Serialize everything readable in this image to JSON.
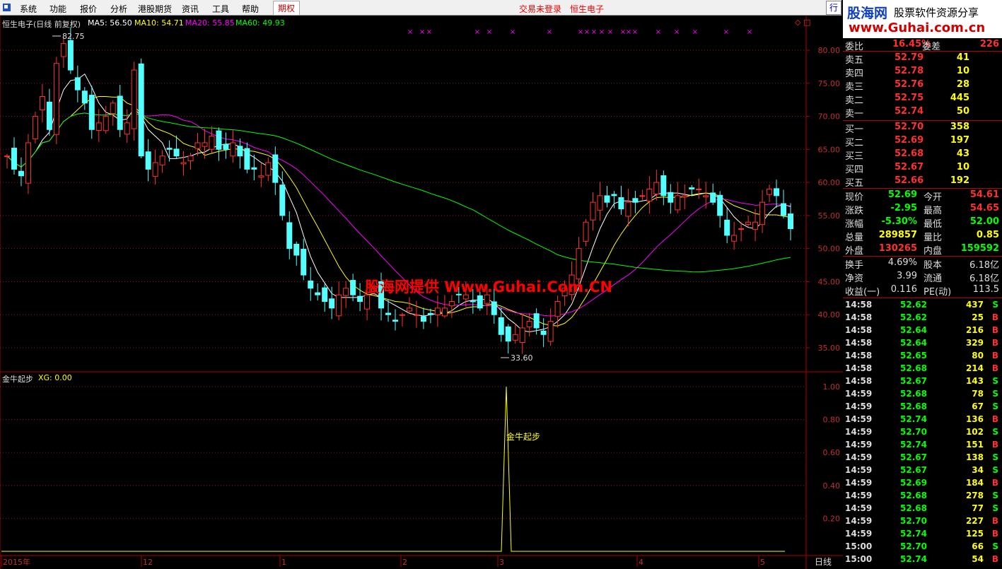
{
  "menu": {
    "items": [
      "系统",
      "功能",
      "报价",
      "分析",
      "港股期货",
      "资讯",
      "工具",
      "帮助"
    ],
    "active": "期权",
    "login_status": "交易未登录",
    "stock_name": "恒生电子",
    "trade_btn": "行"
  },
  "brand": {
    "line1": "股海网",
    "line2": "股票软件资源分享",
    "line3": "www.Guhai.com.cn"
  },
  "watermark": "股海网提供 Www.Guhai.Com.CN",
  "main_chart": {
    "title": "恒生电子(日线 前复权)",
    "ma": [
      {
        "label": "MA5: 56.50",
        "color": "#ffffff"
      },
      {
        "label": "MA10: 54.71",
        "color": "#ffff00"
      },
      {
        "label": "MA20: 55.85",
        "color": "#ff00ff"
      },
      {
        "label": "MA60: 49.93",
        "color": "#00ff00"
      }
    ],
    "y_ticks": [
      "80.00",
      "75.00",
      "70.00",
      "65.00",
      "60.00",
      "55.00",
      "50.00",
      "45.00",
      "40.00",
      "35.00"
    ],
    "high_label": "82.75",
    "low_label": "33.60"
  },
  "chart_data": {
    "type": "candlestick",
    "ylim": [
      32,
      84
    ],
    "x_labels": [
      "2015年",
      "12",
      "1",
      "2",
      "3",
      "4",
      "5"
    ],
    "indicator": {
      "title": "金牛起步",
      "xg_label": "XG: 0.00",
      "y_ticks": [
        "1.00",
        "0.80",
        "0.60",
        "0.40",
        "0.20"
      ],
      "signal_label": "金牛起步",
      "signal_value": 1.0
    }
  },
  "period_label": "日线",
  "quote": {
    "weibi": {
      "label": "委比",
      "value": "16.45%",
      "label2": "委差",
      "value2": "226"
    },
    "sells": [
      {
        "label": "卖五",
        "price": "52.79",
        "vol": "41"
      },
      {
        "label": "卖四",
        "price": "52.78",
        "vol": "10"
      },
      {
        "label": "卖三",
        "price": "52.76",
        "vol": "28"
      },
      {
        "label": "卖二",
        "price": "52.75",
        "vol": "445"
      },
      {
        "label": "卖一",
        "price": "52.74",
        "vol": "50"
      }
    ],
    "buys": [
      {
        "label": "买一",
        "price": "52.70",
        "vol": "358"
      },
      {
        "label": "买二",
        "price": "52.69",
        "vol": "197"
      },
      {
        "label": "买三",
        "price": "52.68",
        "vol": "43"
      },
      {
        "label": "买四",
        "price": "52.67",
        "vol": "10"
      },
      {
        "label": "买五",
        "price": "52.66",
        "vol": "192"
      }
    ],
    "stats1": [
      {
        "l1": "现价",
        "v1": "52.69",
        "c1": "#00ff00",
        "l2": "今开",
        "v2": "54.61",
        "c2": "#ff3030"
      },
      {
        "l1": "涨跌",
        "v1": "-2.95",
        "c1": "#00ff00",
        "l2": "最高",
        "v2": "54.65",
        "c2": "#ff3030"
      },
      {
        "l1": "涨幅",
        "v1": "-5.30%",
        "c1": "#00ff00",
        "l2": "最低",
        "v2": "52.00",
        "c2": "#00ff00"
      },
      {
        "l1": "总量",
        "v1": "289857",
        "c1": "#ffff00",
        "l2": "量比",
        "v2": "0.85",
        "c2": "#ffff00"
      },
      {
        "l1": "外盘",
        "v1": "130265",
        "c1": "#ff3030",
        "l2": "内盘",
        "v2": "159592",
        "c2": "#00ff00"
      }
    ],
    "stats2": [
      {
        "l1": "换手",
        "v1": "4.69%",
        "l2": "股本",
        "v2": "6.18亿"
      },
      {
        "l1": "净资",
        "v1": "3.99",
        "l2": "流通",
        "v2": "6.18亿"
      },
      {
        "l1": "收益(一)",
        "v1": "0.116",
        "l2": "PE(动)",
        "v2": "113.5"
      }
    ]
  },
  "ticks": [
    {
      "t": "14:58",
      "p": "52.62",
      "v": "437",
      "d": "S"
    },
    {
      "t": "14:58",
      "p": "52.62",
      "v": "25",
      "d": "B"
    },
    {
      "t": "14:58",
      "p": "52.64",
      "v": "216",
      "d": "B"
    },
    {
      "t": "14:58",
      "p": "52.64",
      "v": "329",
      "d": "B"
    },
    {
      "t": "14:58",
      "p": "52.65",
      "v": "80",
      "d": "B"
    },
    {
      "t": "14:58",
      "p": "52.68",
      "v": "214",
      "d": "B"
    },
    {
      "t": "14:58",
      "p": "52.67",
      "v": "143",
      "d": "S"
    },
    {
      "t": "14:59",
      "p": "52.68",
      "v": "78",
      "d": "S"
    },
    {
      "t": "14:59",
      "p": "52.68",
      "v": "67",
      "d": "S"
    },
    {
      "t": "14:59",
      "p": "52.74",
      "v": "136",
      "d": "B"
    },
    {
      "t": "14:59",
      "p": "52.70",
      "v": "102",
      "d": "S"
    },
    {
      "t": "14:59",
      "p": "52.74",
      "v": "151",
      "d": "B"
    },
    {
      "t": "14:59",
      "p": "52.67",
      "v": "138",
      "d": "S"
    },
    {
      "t": "14:59",
      "p": "52.67",
      "v": "34",
      "d": "S"
    },
    {
      "t": "14:59",
      "p": "52.69",
      "v": "184",
      "d": "B"
    },
    {
      "t": "14:59",
      "p": "52.68",
      "v": "278",
      "d": "S"
    },
    {
      "t": "14:59",
      "p": "52.68",
      "v": "77",
      "d": "S"
    },
    {
      "t": "14:59",
      "p": "52.70",
      "v": "227",
      "d": "B"
    },
    {
      "t": "14:59",
      "p": "52.74",
      "v": "125",
      "d": "B"
    },
    {
      "t": "15:00",
      "p": "52.70",
      "v": "66",
      "d": "S"
    },
    {
      "t": "15:00",
      "p": "52.74",
      "v": "54",
      "d": "B"
    }
  ]
}
